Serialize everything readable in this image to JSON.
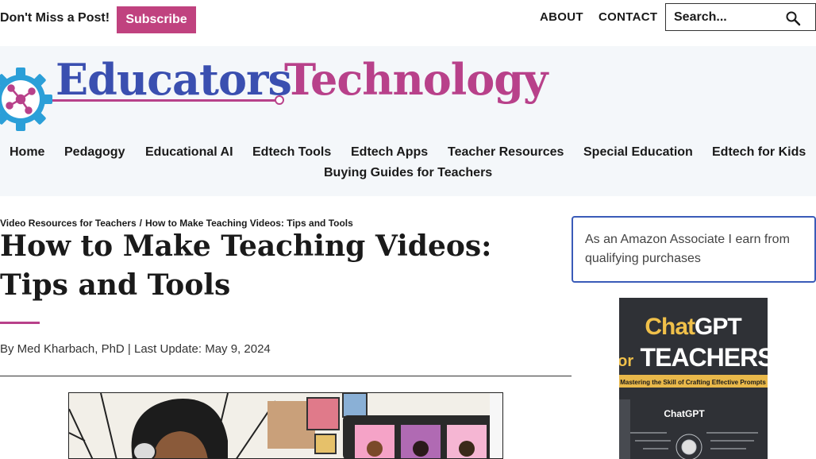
{
  "topbar": {
    "promo_text": "Don't Miss a Post!",
    "subscribe_label": "Subscribe",
    "links": [
      "ABOUT",
      "CONTACT"
    ],
    "search_placeholder": "Search..."
  },
  "header": {
    "logo_word_1": "Educators",
    "logo_word_2": "Technology",
    "nav_items": [
      "Home",
      "Pedagogy",
      "Educational AI",
      "Edtech Tools",
      "Edtech Apps",
      "Teacher Resources",
      "Special Education",
      "Edtech for Kids",
      "Buying Guides for Teachers"
    ]
  },
  "article": {
    "breadcrumb": [
      "Video Resources for Teachers",
      "How to Make Teaching Videos: Tips and Tools"
    ],
    "breadcrumb_separator": "/",
    "title": "How to Make Teaching Videos: Tips and Tools",
    "byline": "By Med Kharbach, PhD | Last Update: May 9, 2024"
  },
  "sidebar": {
    "disclosure": "As an Amazon Associate I earn from qualifying purchases",
    "book": {
      "title_line_1_a": "Chat",
      "title_line_1_b": "GPT",
      "title_line_2_a": "for",
      "title_line_2_b": "TEACHERS",
      "subtitle": "Mastering the Skill of Crafting Effective Prompts",
      "inner_label": "ChatGPT"
    }
  },
  "colors": {
    "brand_blue": "#3a4fb0",
    "brand_magenta": "#b8418a",
    "subscribe_bg": "#c0427f",
    "header_bg": "#f4f7fa",
    "disclosure_border": "#3a5bb8"
  },
  "icons": [
    "search-icon",
    "gear-logo-icon"
  ]
}
